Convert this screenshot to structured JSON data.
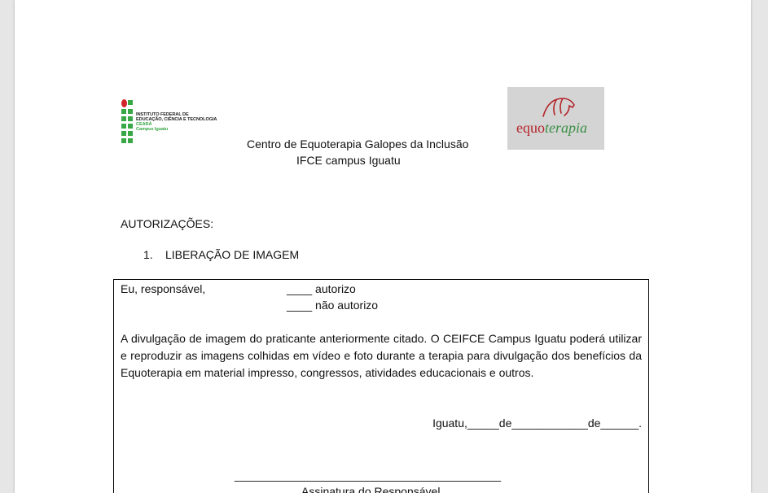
{
  "logos": {
    "ifce": {
      "lines": [
        "INSTITUTO FEDERAL DE",
        "EDUCAÇÃO, CIÊNCIA E TECNOLOGIA",
        "CEARÁ",
        "Campus Iguatu"
      ],
      "colors": {
        "green": "#38a745",
        "red": "#d2232a"
      }
    },
    "equo": {
      "part1": "equo",
      "part2": "terapia",
      "colors": {
        "red": "#b3242a",
        "green": "#3a8f45",
        "background": "#d4d4d4"
      }
    }
  },
  "header": {
    "line1": "Centro de Equoterapia Galopes da Inclusão",
    "line2": "IFCE campus Iguatu"
  },
  "section_title": "AUTORIZAÇÕES:",
  "list_item": {
    "number": "1.",
    "label": "LIBERAÇÃO DE IMAGEM"
  },
  "form": {
    "responsavel": "Eu, responsável,",
    "option1": "____ autorizo",
    "option2": "____ não autorizo",
    "paragraph": "A divulgação de imagem do praticante anteriormente citado. O CEIFCE Campus Iguatu poderá utilizar e reproduzir as imagens colhidas em vídeo e foto durante a terapia para divulgação dos benefícios da Equoterapia em material impresso, congressos, atividades educacionais e outros.",
    "date_line": "Iguatu,_____de____________de______.",
    "signature_line": "__________________________________________",
    "signature_label": "Assinatura do Responsável"
  }
}
